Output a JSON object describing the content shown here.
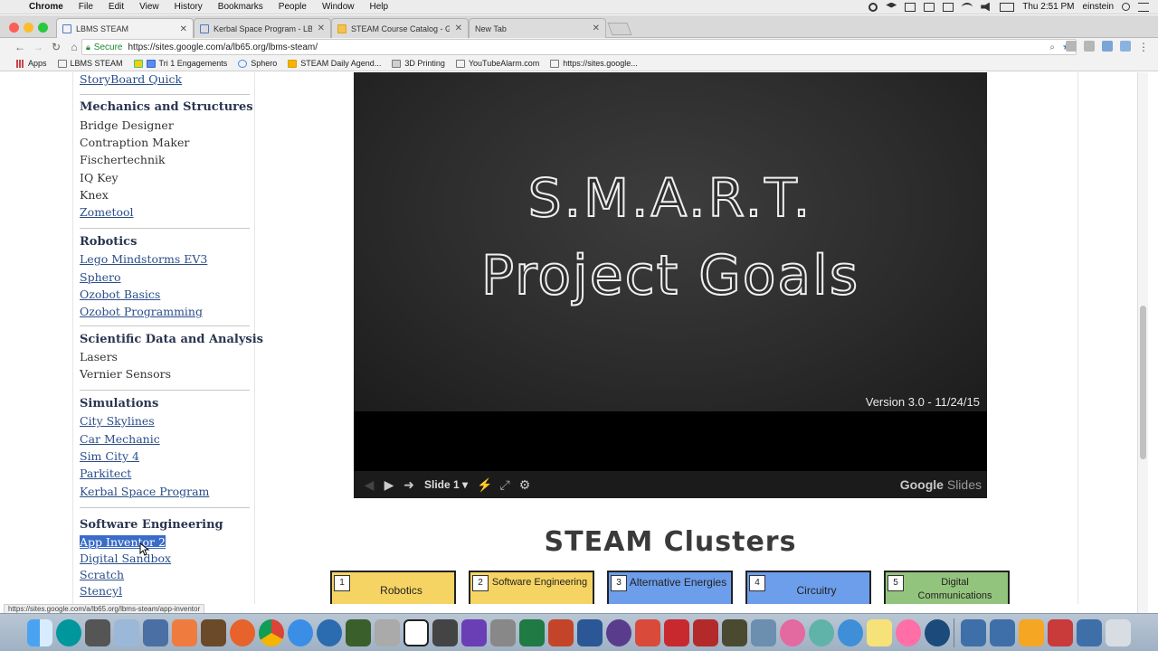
{
  "menubar": {
    "app": "Chrome",
    "items": [
      "File",
      "Edit",
      "View",
      "History",
      "Bookmarks",
      "People",
      "Window",
      "Help"
    ],
    "clock": "Thu 2:51 PM",
    "user": "einstein"
  },
  "tabs": [
    {
      "label": "LBMS STEAM",
      "active": true
    },
    {
      "label": "Kerbal Space Program - LBMS",
      "active": false
    },
    {
      "label": "STEAM Course Catalog - Goo",
      "active": false
    },
    {
      "label": "New Tab",
      "active": false
    }
  ],
  "toolbar": {
    "secure_label": "Secure",
    "url": "https://sites.google.com/a/lb65.org/lbms-steam/"
  },
  "bookmarks": [
    "Apps",
    "LBMS STEAM",
    "Tri 1 Engagements",
    "Sphero",
    "STEAM Daily Agend...",
    "3D Printing",
    "YouTubeAlarm.com",
    "https://sites.google..."
  ],
  "sidebar": {
    "top_link": "StoryBoard Quick",
    "sections": [
      {
        "heading": "Mechanics and Structures",
        "items": [
          {
            "label": "Bridge Designer",
            "link": false
          },
          {
            "label": "Contraption Maker",
            "link": false
          },
          {
            "label": "Fischertechnik",
            "link": false
          },
          {
            "label": "IQ Key",
            "link": false
          },
          {
            "label": "Knex",
            "link": false
          },
          {
            "label": "Zometool",
            "link": true
          }
        ]
      },
      {
        "heading": "Robotics",
        "items": [
          {
            "label": "Lego Mindstorms EV3",
            "link": true
          },
          {
            "label": "Sphero",
            "link": true
          },
          {
            "label": "Ozobot Basics",
            "link": true
          },
          {
            "label": "Ozobot Programming",
            "link": true
          }
        ]
      },
      {
        "heading": "Scientific Data and Analysis",
        "items": [
          {
            "label": "Lasers",
            "link": false
          },
          {
            "label": "Vernier Sensors",
            "link": false
          }
        ]
      },
      {
        "heading": "Simulations",
        "items": [
          {
            "label": "City Skylines",
            "link": true
          },
          {
            "label": "Car Mechanic",
            "link": true
          },
          {
            "label": "Sim City 4",
            "link": true
          },
          {
            "label": "Parkitect",
            "link": true
          },
          {
            "label": "Kerbal Space Program",
            "link": true
          }
        ]
      },
      {
        "heading": "Software Engineering",
        "items": [
          {
            "label": "App Inventor 2",
            "link": true
          },
          {
            "label": "Digital Sandbox",
            "link": true
          },
          {
            "label": "Scratch",
            "link": true
          },
          {
            "label": "Stencyl",
            "link": true
          }
        ]
      }
    ]
  },
  "slides": {
    "title_line1": "S.M.A.R.T.",
    "title_line2": "Project Goals",
    "version": "Version 3.0 - 11/24/15",
    "slide_label": "Slide 1",
    "brand_google": "Google",
    "brand_slides": "Slides"
  },
  "clusters": {
    "title": "STEAM Clusters",
    "items": [
      {
        "num": "1",
        "label": "Robotics",
        "color": "#f6d463"
      },
      {
        "num": "2",
        "label": "Software Engineering",
        "color": "#f6d463"
      },
      {
        "num": "3",
        "label": "Alternative Energies",
        "color": "#6d9eeb"
      },
      {
        "num": "4",
        "label": "Circuitry",
        "color": "#6d9eeb"
      },
      {
        "num": "5",
        "label": "Digital Communications",
        "color": "#93c47d"
      }
    ]
  },
  "status_url": "https://sites.google.com/a/lb65.org/lbms-steam/app-inventor"
}
